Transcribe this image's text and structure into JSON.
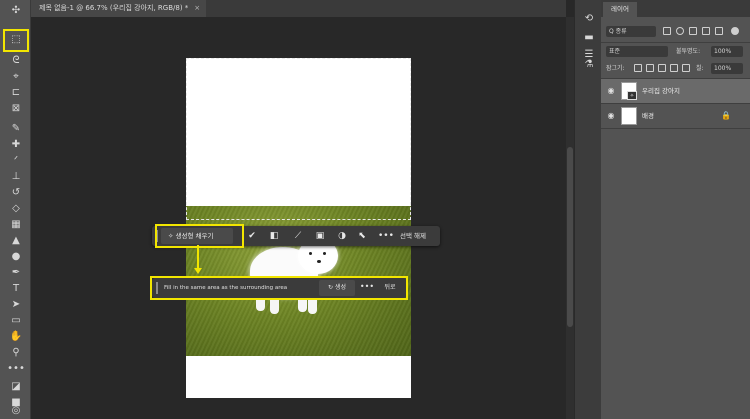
{
  "document": {
    "tab_title": "제목 없음-1 @ 66.7% (우리집 강아지, RGB/8) *",
    "tab_close": "×"
  },
  "toolbar": {
    "tools": [
      "move-icon",
      "rectangular-marquee-icon",
      "lasso-icon",
      "object-selection-icon",
      "crop-icon",
      "frame-icon",
      "eyedropper-icon",
      "spot-healing-brush-icon",
      "brush-icon",
      "clone-stamp-icon",
      "history-brush-icon",
      "eraser-icon",
      "gradient-icon",
      "blur-icon",
      "dodge-icon",
      "pen-icon",
      "type-icon",
      "path-selection-icon",
      "rectangle-icon",
      "hand-icon",
      "zoom-icon",
      "more-tools-icon",
      "default-colors-icon",
      "foreground-color-swatch",
      "quick-mask-icon",
      "screen-mode-icon"
    ],
    "glyphs": [
      "✣",
      "⬚",
      "ᘓ",
      "⌖",
      "⊏",
      "⊠",
      "✎",
      "✚",
      "ᐟ",
      "⊥",
      "↺",
      "◇",
      "▦",
      "▲",
      "●",
      "✒",
      "T",
      "➤",
      "▭",
      "✋",
      "⚲",
      "•••",
      "◪",
      "■",
      "◎",
      "▢"
    ],
    "active_tool": "rectangular-marquee-icon"
  },
  "contextual_task_bar": {
    "generative_fill_label": "생성형 채우기",
    "generative_fill_glyph": "✧",
    "icons": [
      "select-subject-icon",
      "invert-selection-icon",
      "modify-selection-icon",
      "mask-icon",
      "adjustment-icon",
      "transform-icon",
      "more-icon"
    ],
    "icon_glyphs": [
      "✔",
      "◧",
      "⟋",
      "▣",
      "◑",
      "⬉",
      "•••"
    ],
    "deselect_label": "선택 해제"
  },
  "prompt_bar": {
    "prompt_text": "Fill in the same area as the surrounding area",
    "generate_label": "생성",
    "generate_glyph": "↻",
    "more_label": "•••",
    "back_label": "뒤로"
  },
  "right_icons": {
    "icons": [
      "history-icon",
      "comments-icon",
      "properties-icon",
      "libraries-icon"
    ],
    "glyphs": [
      "⟲",
      "▬",
      "☰",
      "⚗"
    ]
  },
  "layers_panel": {
    "tab_label": "레이어",
    "search_label": "Q 종류",
    "blend_mode": "표준",
    "opacity_label": "불투명도:",
    "opacity_value": "100%",
    "lock_label": "잠그기:",
    "fill_label": "칠:",
    "fill_value": "100%",
    "layers": [
      {
        "name": "우리집 강아지",
        "visible": true,
        "selected": true,
        "generative": true
      },
      {
        "name": "배경",
        "visible": true,
        "selected": false,
        "locked": true
      }
    ],
    "eye_glyph": "◉",
    "lock_glyph": "🔒"
  },
  "colors": {
    "highlight": "#f2e600",
    "panel_bg": "#535353",
    "canvas_bg": "#282828"
  }
}
